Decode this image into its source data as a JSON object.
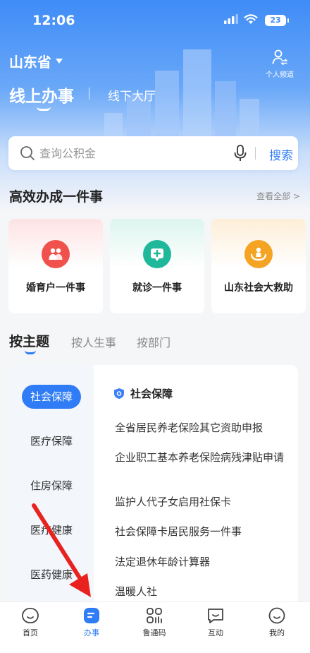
{
  "status": {
    "time": "12:06",
    "battery": "23"
  },
  "header": {
    "province": "山东省",
    "personal_channel": "个人频道",
    "tabs": {
      "online": "线上办事",
      "offline": "线下大厅"
    }
  },
  "search": {
    "placeholder": "查询公积金",
    "button": "搜索"
  },
  "featured": {
    "title": "高效办成一件事",
    "view_all": "查看全部 >",
    "cards": [
      {
        "label": "婚育户一件事",
        "icon": "family-icon",
        "color": "#f0514d"
      },
      {
        "label": "就诊一件事",
        "icon": "medical-plus-icon",
        "color": "#1fb89a"
      },
      {
        "label": "山东社会大救助",
        "icon": "rescue-hands-icon",
        "color": "#f4a323"
      }
    ]
  },
  "topic_tabs": [
    "按主题",
    "按人生事",
    "按部门"
  ],
  "sidebar": [
    "社会保障",
    "医疗保障",
    "住房保障",
    "医疗健康",
    "医药健康"
  ],
  "list": {
    "header": "社会保障",
    "items": [
      "全省居民养老保险其它资助申报",
      "企业职工基本养老保险病残津贴申请",
      "监护人代子女启用社保卡",
      "社会保障卡居民服务一件事",
      "法定退休年龄计算器",
      "温暖人社"
    ]
  },
  "bottom_nav": [
    {
      "label": "首页",
      "icon": "home-icon"
    },
    {
      "label": "办事",
      "icon": "service-icon",
      "active": true
    },
    {
      "label": "鲁通码",
      "icon": "qr-code-icon"
    },
    {
      "label": "互动",
      "icon": "chat-icon"
    },
    {
      "label": "我的",
      "icon": "profile-icon"
    }
  ],
  "colors": {
    "primary": "#2f7cf6",
    "arrow": "#e8231f"
  }
}
